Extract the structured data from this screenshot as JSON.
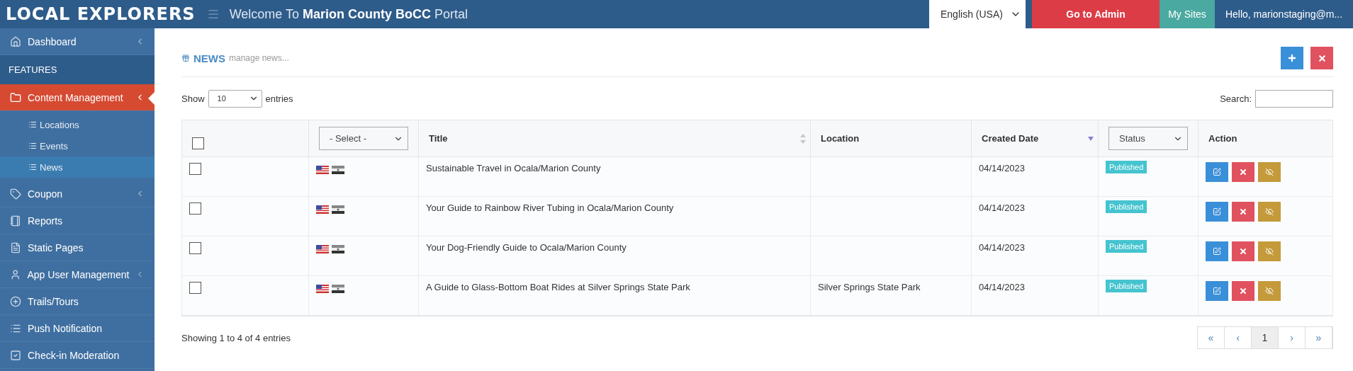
{
  "topbar": {
    "logo": "LOCAL EXPLORERS",
    "welcome": "Welcome To **Marion County BoCC** Portal",
    "language": "English (USA)",
    "admin_button": "Go to Admin",
    "sites_button": "My Sites",
    "user": "Hello, marionstaging@m..."
  },
  "sidebar": {
    "items": [
      {
        "kind": "item",
        "label": "Dashboard",
        "expandable": true,
        "selected": false
      },
      {
        "kind": "header",
        "label": "FEATURES"
      },
      {
        "kind": "item",
        "label": "Content Management",
        "expandable": true,
        "selected": true,
        "children": [
          {
            "label": "Locations",
            "selected": false
          },
          {
            "label": "Events",
            "selected": false
          },
          {
            "label": "News",
            "selected": true
          }
        ]
      },
      {
        "kind": "item",
        "label": "Coupon",
        "expandable": true,
        "selected": false
      },
      {
        "kind": "item",
        "label": "Reports",
        "expandable": false,
        "selected": false
      },
      {
        "kind": "item",
        "label": "Static Pages",
        "expandable": false,
        "selected": false
      },
      {
        "kind": "item",
        "label": "App User Management",
        "expandable": true,
        "selected": false
      },
      {
        "kind": "item",
        "label": "Trails/Tours",
        "expandable": false,
        "selected": false
      },
      {
        "kind": "item",
        "label": "Push Notification",
        "expandable": false,
        "selected": false
      },
      {
        "kind": "item",
        "label": "Check-in Moderation",
        "expandable": false,
        "selected": false
      }
    ]
  },
  "page": {
    "title": "NEWS",
    "subtitle": "manage news...",
    "show_label": "Show",
    "page_size": "10",
    "entries_label": "entries",
    "search_label": "Search:"
  },
  "table": {
    "all_checked": false,
    "language_filter": "- Select -",
    "status_filter": "Status",
    "columns": [
      "Title",
      "Location",
      "Created Date",
      "Action"
    ],
    "rows": [
      {
        "checked": false,
        "title": "Sustainable Travel in Ocala/Marion County",
        "location": "",
        "created_date": "04/14/2023",
        "status": "Published"
      },
      {
        "checked": false,
        "title": "Your Guide to Rainbow River Tubing in Ocala/Marion County",
        "location": "",
        "created_date": "04/14/2023",
        "status": "Published"
      },
      {
        "checked": false,
        "title": "Your Dog-Friendly Guide to Ocala/Marion County",
        "location": "",
        "created_date": "04/14/2023",
        "status": "Published"
      },
      {
        "checked": false,
        "title": "A Guide to Glass-Bottom Boat Rides at Silver Springs State Park",
        "location": "Silver Springs State Park",
        "created_date": "04/14/2023",
        "status": "Published"
      }
    ]
  },
  "footer": {
    "info": "Showing 1 to 4 of 4 entries",
    "pagination": [
      {
        "label": "«",
        "selected": false
      },
      {
        "label": "‹",
        "selected": false
      },
      {
        "label": "1",
        "selected": true
      },
      {
        "label": "›",
        "selected": false
      },
      {
        "label": "»",
        "selected": false
      }
    ]
  }
}
